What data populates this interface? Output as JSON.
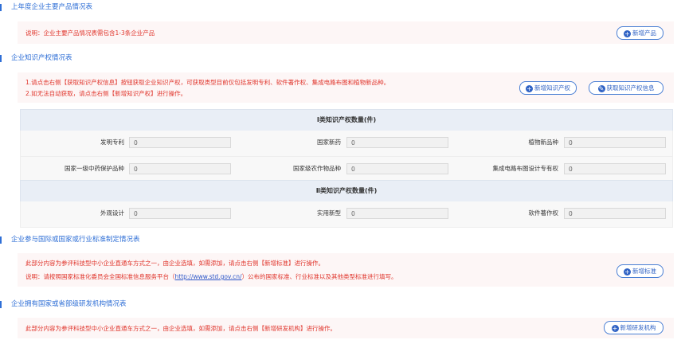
{
  "sections": {
    "products": {
      "title": "上年度企业主要产品情况表",
      "note": "说明：企业主要产品情况表需包含1-3条企业产品",
      "add_button": "新增产品"
    },
    "ip": {
      "title": "企业知识产权情况表",
      "note_line1": "1.请点击右侧【获取知识产权信息】按钮获取企业知识产权，可获取类型目前仅包括发明专利、软件著作权、集成电路布图和植物新品种。",
      "note_line2": "2.如无法自动获取，请点击右侧【新增知识产权】进行操作。",
      "add_button": "新增知识产权",
      "fetch_button": "获取知识产权信息",
      "class1_header": "Ⅰ类知识产权数量(件)",
      "class1_fields": [
        {
          "label": "发明专利",
          "value": "0"
        },
        {
          "label": "国家新药",
          "value": "0"
        },
        {
          "label": "植物新品种",
          "value": "0"
        },
        {
          "label": "国家一级中药保护品种",
          "value": "0"
        },
        {
          "label": "国家级农作物品种",
          "value": "0"
        },
        {
          "label": "集成电路布图设计专有权",
          "value": "0"
        }
      ],
      "class2_header": "Ⅱ类知识产权数量(件)",
      "class2_fields": [
        {
          "label": "外观设计",
          "value": "0"
        },
        {
          "label": "实用新型",
          "value": "0"
        },
        {
          "label": "软件著作权",
          "value": "0"
        }
      ]
    },
    "standards": {
      "title": "企业参与国际或国家或行业标准制定情况表",
      "note_line1": "此部分内容为参评科技型中小企业直通车方式之一，由企业选填，如需添加，请点击右侧【新增标准】进行操作。",
      "note_line2_prefix": "说明：请按照国家标准化委员会全国标准信息服务平台（",
      "note_line2_link": "http://www.std.gov.cn/",
      "note_line2_suffix": "）公布的国家标准、行业标准以及其他类型标准进行填写。",
      "add_button": "新增标准"
    },
    "rnd": {
      "title": "企业拥有国家或省部级研发机构情况表",
      "note": "此部分内容为参评科技型中小企业直通车方式之一，由企业选填，如需添加，请点击右侧【新增研发机构】进行操作。",
      "add_button": "新增研发机构"
    }
  },
  "colors": {
    "accent": "#2f6fd6",
    "warning_text": "#e0342b",
    "note_bg": "#fdf6f6"
  },
  "icons": {
    "add": "plus-circle-icon",
    "fetch": "edit-pencil-icon"
  }
}
